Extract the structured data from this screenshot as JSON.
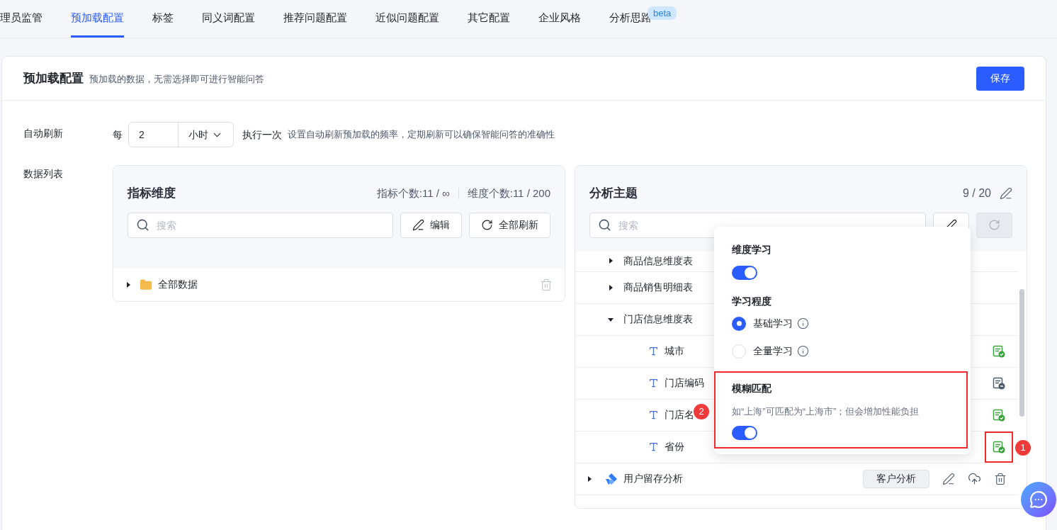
{
  "tabs": [
    {
      "label": "理员监管",
      "selected": false
    },
    {
      "label": "预加载配置",
      "selected": true
    },
    {
      "label": "标签",
      "selected": false
    },
    {
      "label": "同义词配置",
      "selected": false
    },
    {
      "label": "推荐问题配置",
      "selected": false
    },
    {
      "label": "近似问题配置",
      "selected": false
    },
    {
      "label": "其它配置",
      "selected": false
    },
    {
      "label": "企业风格",
      "selected": false
    },
    {
      "label": "分析思路",
      "selected": false,
      "badge": "beta"
    }
  ],
  "header": {
    "title": "预加载配置",
    "subtitle": "预加载的数据，无需选择即可进行智能问答",
    "save_button": "保存"
  },
  "auto_refresh": {
    "label": "自动刷新",
    "prefix": "每",
    "value": "2",
    "unit": "小时",
    "suffix": "执行一次",
    "hint": "设置自动刷新预加载的频率，定期刷新可以确保智能问答的准确性"
  },
  "data_list_label": "数据列表",
  "metrics_panel": {
    "title": "指标维度",
    "counts": [
      "指标个数:11 / ∞",
      "维度个数:11 / 200"
    ],
    "search_placeholder": "搜索",
    "buttons": [
      {
        "label": "编辑",
        "kind": "edit",
        "disabled": false
      },
      {
        "label": "全部刷新",
        "kind": "refresh",
        "disabled": false
      }
    ],
    "tree": [
      {
        "label": "全部数据",
        "expanded": false
      }
    ]
  },
  "topics_panel": {
    "title": "分析主题",
    "count": "9 / 20",
    "search_placeholder": "搜索",
    "buttons": [
      {
        "kind": "edit",
        "disabled": false
      },
      {
        "kind": "refresh",
        "disabled": true
      }
    ],
    "rows": [
      {
        "kind": "table",
        "label": "商品信息维度表",
        "expanded": false
      },
      {
        "kind": "table",
        "label": "商品销售明细表",
        "expanded": false
      },
      {
        "kind": "table",
        "label": "门店信息维度表",
        "expanded": true
      },
      {
        "kind": "field",
        "label": "城市",
        "learned": true,
        "highlighted": false
      },
      {
        "kind": "field",
        "label": "门店编码",
        "learned": false,
        "highlighted": false
      },
      {
        "kind": "field",
        "label": "门店名",
        "learned": true,
        "highlighted": false
      },
      {
        "kind": "field",
        "label": "省份",
        "learned": true,
        "highlighted": true
      },
      {
        "kind": "topic",
        "label": "用户留存分析",
        "tag": "客户分析",
        "expanded": false
      }
    ]
  },
  "popover": {
    "dimension_learning": {
      "title": "维度学习",
      "on": true
    },
    "level": {
      "title": "学习程度",
      "options": [
        {
          "label": "基础学习",
          "selected": true
        },
        {
          "label": "全量学习",
          "selected": false
        }
      ]
    },
    "fuzzy": {
      "title": "模糊匹配",
      "description": "如“上海”可匹配为“上海市”；但会增加性能负担",
      "on": true,
      "highlighted": true
    }
  },
  "markers": [
    "1",
    "2"
  ]
}
